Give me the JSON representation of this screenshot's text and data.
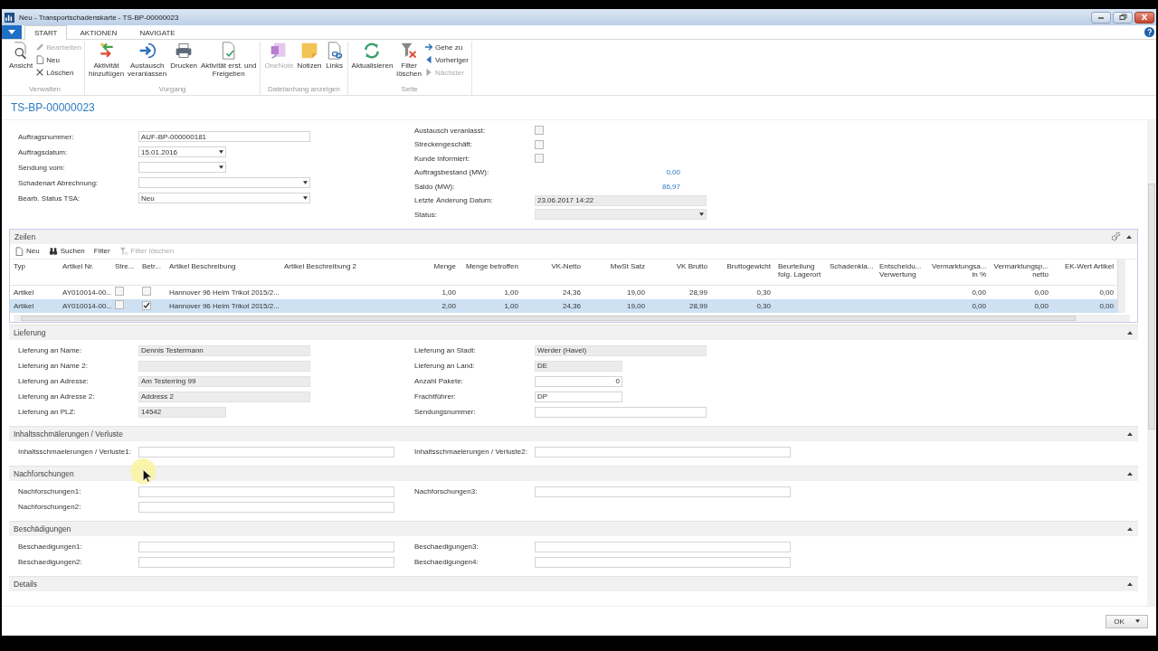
{
  "window": {
    "title": "Neu - Transportschadenskarte - TS-BP-00000023"
  },
  "ribbon": {
    "tabs": [
      {
        "label": "START",
        "selected": true
      },
      {
        "label": "AKTIONEN",
        "selected": false
      },
      {
        "label": "NAVIGATE",
        "selected": false
      }
    ],
    "groups": [
      {
        "label": "Verwalten",
        "items": [
          {
            "kind": "large",
            "label": "Ansicht",
            "disabled": false
          },
          {
            "kind": "stack",
            "items": [
              {
                "label": "Bearbeiten",
                "disabled": true
              },
              {
                "label": "Neu",
                "disabled": false
              },
              {
                "label": "Löschen",
                "disabled": false
              }
            ]
          }
        ]
      },
      {
        "label": "Vorgang",
        "items": [
          {
            "kind": "large",
            "label": "Aktivität\nhinzufügen",
            "disabled": false
          },
          {
            "kind": "large",
            "label": "Austausch\nveranlassen",
            "disabled": false
          },
          {
            "kind": "large",
            "label": "Drucken",
            "disabled": false
          },
          {
            "kind": "large",
            "label": "Aktivität erst. und\nFreigeben",
            "disabled": false
          }
        ]
      },
      {
        "label": "Dateianhang anzeigen",
        "items": [
          {
            "kind": "large",
            "label": "OneNote",
            "disabled": true
          },
          {
            "kind": "large",
            "label": "Notizen",
            "disabled": false
          },
          {
            "kind": "large",
            "label": "Links",
            "disabled": false
          }
        ]
      },
      {
        "label": "Seite",
        "items": [
          {
            "kind": "large",
            "label": "Aktualisieren",
            "disabled": false
          },
          {
            "kind": "large",
            "label": "Filter\nlöschen",
            "disabled": false
          },
          {
            "kind": "stack",
            "items": [
              {
                "label": "Gehe zu",
                "disabled": false
              },
              {
                "label": "Vorheriger",
                "disabled": false
              },
              {
                "label": "Nächster",
                "disabled": true
              }
            ]
          }
        ]
      }
    ]
  },
  "record_title": "TS-BP-00000023",
  "general": {
    "left": [
      {
        "label": "Auftragsnummer:",
        "kind": "text",
        "value": "AUF-BP-000000181"
      },
      {
        "label": "Auftragsdatum:",
        "kind": "date",
        "value": "15.01.2016"
      },
      {
        "label": "Sendung vom:",
        "kind": "date"
      },
      {
        "label": "Schadenart Abrechnung:",
        "kind": "dropdown"
      },
      {
        "label": "Bearb. Status TSA:",
        "kind": "dropdown",
        "value": "Neu"
      }
    ],
    "right": [
      {
        "label": "Austausch veranlasst:",
        "kind": "checkbox",
        "checked": false
      },
      {
        "label": "Streckengeschäft:",
        "kind": "checkbox",
        "checked": false
      },
      {
        "label": "Kunde informiert:",
        "kind": "checkbox",
        "checked": false
      },
      {
        "label": "Auftragsbestand (MW):",
        "kind": "amount",
        "value": "0,00"
      },
      {
        "label": "Saldo (MW):",
        "kind": "amount",
        "value": "86,97"
      },
      {
        "label": "Letzte Änderung Datum:",
        "kind": "readonly",
        "value": "23.06.2017 14:22"
      },
      {
        "label": "Status:",
        "kind": "readonly-dropdown"
      }
    ]
  },
  "lines": {
    "title": "Zeilen",
    "expanded": true,
    "toolbar": [
      {
        "label": "Neu",
        "disabled": false
      },
      {
        "label": "Suchen",
        "disabled": false
      },
      {
        "label": "Filter",
        "disabled": false
      },
      {
        "label": "Filter löschen",
        "disabled": true
      }
    ],
    "columns": [
      {
        "label": "Typ",
        "kind": "text"
      },
      {
        "label": "Artikel Nr.",
        "kind": "text"
      },
      {
        "label": "Stre...",
        "kind": "check"
      },
      {
        "label": "Betr...",
        "kind": "check"
      },
      {
        "label": "Artikel Beschreibung",
        "kind": "text"
      },
      {
        "label": "Artikel Beschreibung 2",
        "kind": "text"
      },
      {
        "label": "Menge",
        "kind": "num"
      },
      {
        "label": "Menge betroffen",
        "kind": "num"
      },
      {
        "label": "VK-Netto",
        "kind": "num"
      },
      {
        "label": "MwSt Satz",
        "kind": "num"
      },
      {
        "label": "VK Brutto",
        "kind": "num"
      },
      {
        "label": "Bruttogewicht",
        "kind": "num"
      },
      {
        "label": "Beurteilung\nfolg. Lagerort",
        "kind": "text"
      },
      {
        "label": "Schadenkla...",
        "kind": "text"
      },
      {
        "label": "Entscheidu...\nVerwertung",
        "kind": "text"
      },
      {
        "label": "Vermarktungsa...\nin %",
        "kind": "num"
      },
      {
        "label": "Vermarktungsp...\nnetto",
        "kind": "num"
      },
      {
        "label": "EK-Wert Artikel",
        "kind": "num"
      }
    ],
    "rows": [
      {
        "selected": false,
        "typ": "Artikel",
        "nr": "AY010014-00...",
        "stre": false,
        "betr": false,
        "beschr": "Hannover 96 Heim Trikot 2015/2...",
        "menge": "1,00",
        "betroffen": "1,00",
        "vknetto": "24,36",
        "mwst": "19,00",
        "vkbrutto": "28,99",
        "gewicht": "0,30",
        "verma": "0,00",
        "vermp": "0,00",
        "ekwert": "0,00"
      },
      {
        "selected": true,
        "typ": "Artikel",
        "nr": "AY010014-00...",
        "stre": false,
        "betr": true,
        "beschr": "Hannover 96 Heim Trikot 2015/2...",
        "menge": "2,00",
        "betroffen": "1,00",
        "vknetto": "24,36",
        "mwst": "19,00",
        "vkbrutto": "28,99",
        "gewicht": "0,30",
        "verma": "0,00",
        "vermp": "0,00",
        "ekwert": "0,00"
      }
    ]
  },
  "sections": [
    {
      "title": "Lieferung",
      "expanded": true,
      "left": [
        {
          "label": "Lieferung an Name:",
          "kind": "readonly",
          "value": "Dennis Testermann"
        },
        {
          "label": "Lieferung an Name 2:",
          "kind": "readonly"
        },
        {
          "label": "Lieferung an Adresse:",
          "kind": "readonly",
          "value": "Am Testerring 99"
        },
        {
          "label": "Lieferung an Adresse 2:",
          "kind": "readonly",
          "value": "Address 2"
        },
        {
          "label": "Lieferung an PLZ:",
          "kind": "readonly-short",
          "value": "14542"
        }
      ],
      "right": [
        {
          "label": "Lieferung an Stadt:",
          "kind": "readonly",
          "value": "Werder (Havel)"
        },
        {
          "label": "Lieferung an Land:",
          "kind": "readonly-short",
          "value": "DE"
        },
        {
          "label": "Anzahl Pakete:",
          "kind": "number",
          "value": "0"
        },
        {
          "label": "Frachtführer:",
          "kind": "text-short",
          "value": "DP"
        },
        {
          "label": "Sendungsnummer:",
          "kind": "text"
        }
      ]
    },
    {
      "title": "Inhaltsschmälerungen / Verluste",
      "expanded": true,
      "left": [
        {
          "label": "Inhaltsschmaelerungen / Verluste1:",
          "kind": "memo"
        }
      ],
      "right": [
        {
          "label": "Inhaltsschmaelerungen / Verluste2:",
          "kind": "memo"
        }
      ]
    },
    {
      "title": "Nachforschungen",
      "expanded": true,
      "left": [
        {
          "label": "Nachforschungen1:",
          "kind": "memo"
        },
        {
          "label": "Nachforschungen2:",
          "kind": "memo"
        }
      ],
      "right": [
        {
          "label": "Nachforschungen3:",
          "kind": "memo"
        }
      ]
    },
    {
      "title": "Beschädigungen",
      "expanded": true,
      "left": [
        {
          "label": "Beschaedigungen1:",
          "kind": "memo"
        },
        {
          "label": "Beschaedigungen2:",
          "kind": "memo"
        }
      ],
      "right": [
        {
          "label": "Beschaedigungen3:",
          "kind": "memo"
        },
        {
          "label": "Beschaedigungen4:",
          "kind": "memo"
        }
      ]
    },
    {
      "title": "Details",
      "expanded": true
    }
  ],
  "footer": {
    "ok": "OK"
  }
}
